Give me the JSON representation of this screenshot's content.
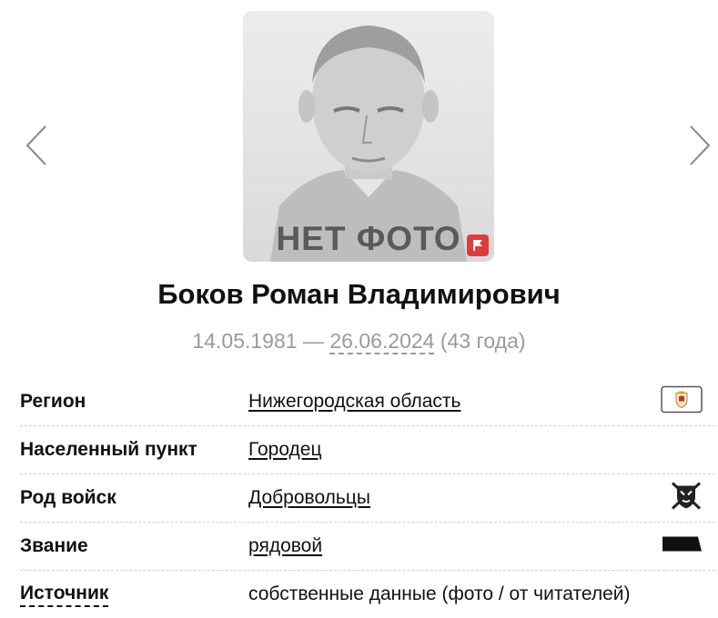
{
  "photo": {
    "placeholder_text": "НЕТ ФОТО"
  },
  "person": {
    "name": "Боков Роман Владимирович",
    "birth_date": "14.05.1981",
    "separator": "—",
    "death_date": "26.06.2024",
    "age": "(43 года)"
  },
  "info": {
    "rows": [
      {
        "label": "Регион",
        "value": "Нижегородская область",
        "icon": "region-coat-of-arms-icon"
      },
      {
        "label": "Населенный пункт",
        "value": "Городец"
      },
      {
        "label": "Род войск",
        "value": "Добровольцы",
        "icon": "volunteers-emblem-icon"
      },
      {
        "label": "Звание",
        "value": "рядовой",
        "icon": "rank-insignia-icon"
      },
      {
        "label": "Источник",
        "value": "собственные данные (фото / от читателей)"
      }
    ]
  },
  "icons": [
    "chevron-left-icon",
    "chevron-right-icon",
    "flag-icon"
  ],
  "colors": {
    "muted_text": "#9a9a9a",
    "flag_red": "#e03c3c",
    "text": "#111111"
  }
}
